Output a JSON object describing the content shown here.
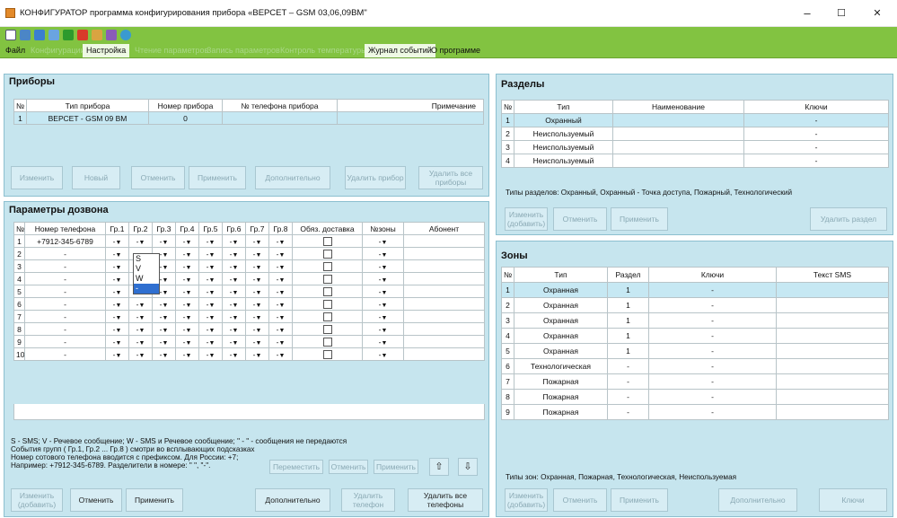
{
  "window": {
    "title": "КОНФИГУРАТОР программа конфигурирования прибора «ВЕРСЕТ – GSM 03,06,09ВМ\"",
    "minimize": "–",
    "maximize": "☐",
    "close": "✕"
  },
  "menu": {
    "items": [
      "Файл",
      "Конфигурации",
      "Настройка",
      "Чтение параметров",
      "Запись параметров",
      "Контроль температуры",
      "Журнал событий",
      "О программе"
    ]
  },
  "devices": {
    "title": "Приборы",
    "headers": [
      "№",
      "Тип прибора",
      "Номер прибора",
      "№ телефона прибора",
      "Примечание"
    ],
    "rows": [
      [
        "1",
        "ВЕРСЕТ - GSM 09 ВМ",
        "0",
        "",
        ""
      ]
    ],
    "buttons": [
      "Изменить",
      "Новый",
      "Отменить",
      "Применить",
      "Дополнительно",
      "Удалить прибор",
      "Удалить все приборы"
    ]
  },
  "dial": {
    "title": "Параметры дозвона",
    "headers": [
      "№",
      "Номер телефона",
      "Гр.1",
      "Гр.2",
      "Гр.3",
      "Гр.4",
      "Гр.5",
      "Гр.6",
      "Гр.7",
      "Гр.8",
      "Обяз. доставка",
      "№зоны",
      "Абонент"
    ],
    "rows": [
      [
        "1",
        "+7912-345-6789",
        "-",
        "-",
        "-",
        "-",
        "-",
        "-",
        "-",
        "-",
        "",
        "-",
        ""
      ],
      [
        "2",
        "-",
        "-",
        "-",
        "-",
        "-",
        "-",
        "-",
        "-",
        "-",
        "",
        "-",
        ""
      ],
      [
        "3",
        "-",
        "-",
        "-",
        "-",
        "-",
        "-",
        "-",
        "-",
        "-",
        "",
        "-",
        ""
      ],
      [
        "4",
        "-",
        "-",
        "-",
        "-",
        "-",
        "-",
        "-",
        "-",
        "-",
        "",
        "-",
        ""
      ],
      [
        "5",
        "-",
        "-",
        "-",
        "-",
        "-",
        "-",
        "-",
        "-",
        "-",
        "",
        "-",
        ""
      ],
      [
        "6",
        "-",
        "-",
        "-",
        "-",
        "-",
        "-",
        "-",
        "-",
        "-",
        "",
        "-",
        ""
      ],
      [
        "7",
        "-",
        "-",
        "-",
        "-",
        "-",
        "-",
        "-",
        "-",
        "-",
        "",
        "-",
        ""
      ],
      [
        "8",
        "-",
        "-",
        "-",
        "-",
        "-",
        "-",
        "-",
        "-",
        "-",
        "",
        "-",
        ""
      ],
      [
        "9",
        "-",
        "-",
        "-",
        "-",
        "-",
        "-",
        "-",
        "-",
        "-",
        "",
        "-",
        ""
      ],
      [
        "10",
        "-",
        "-",
        "-",
        "-",
        "-",
        "-",
        "-",
        "-",
        "-",
        "",
        "-",
        ""
      ]
    ],
    "dropdown_options": [
      "S",
      "V",
      "W",
      "-"
    ],
    "notes": [
      "S - SMS;  V - Речевое сообщение;  W - SMS и Речевое сообщение; \" - \" - сообщения не передаются",
      "События групп ( Гр.1, Гр.2 ... Гр.8 ) смотри во всплывающих подсказках",
      "Номер сотового телефона вводится с префиксом. Для России: +7;",
      "Например: +7912-345-6789. Разделители в номере: \" \", \"-\"."
    ],
    "small_buttons": [
      "Переместить",
      "Отменить",
      "Применить"
    ],
    "buttons": [
      "Изменить (добавить)",
      "Отменить",
      "Применить",
      "Дополнительно",
      "Удалить телефон",
      "Удалить все телефоны"
    ]
  },
  "sections": {
    "title": "Разделы",
    "headers": [
      "№",
      "Тип",
      "Наименование",
      "Ключи"
    ],
    "rows": [
      [
        "1",
        "Охранный",
        "",
        "-"
      ],
      [
        "2",
        "Неиспользуемый",
        "",
        "-"
      ],
      [
        "3",
        "Неиспользуемый",
        "",
        "-"
      ],
      [
        "4",
        "Неиспользуемый",
        "",
        "-"
      ]
    ],
    "types_note": "Типы разделов: Охранный, Охранный - Точка доступа, Пожарный, Технологический",
    "buttons": [
      "Изменить (добавить)",
      "Отменить",
      "Применить",
      "Удалить раздел"
    ]
  },
  "zones": {
    "title": "Зоны",
    "headers": [
      "№",
      "Тип",
      "Раздел",
      "Ключи",
      "Текст SMS"
    ],
    "rows": [
      [
        "1",
        "Охранная",
        "1",
        "-",
        ""
      ],
      [
        "2",
        "Охранная",
        "1",
        "-",
        ""
      ],
      [
        "3",
        "Охранная",
        "1",
        "-",
        ""
      ],
      [
        "4",
        "Охранная",
        "1",
        "-",
        ""
      ],
      [
        "5",
        "Охранная",
        "1",
        "-",
        ""
      ],
      [
        "6",
        "Технологическая",
        "-",
        "-",
        ""
      ],
      [
        "7",
        "Пожарная",
        "-",
        "-",
        ""
      ],
      [
        "8",
        "Пожарная",
        "-",
        "-",
        ""
      ],
      [
        "9",
        "Пожарная",
        "-",
        "-",
        ""
      ]
    ],
    "types_note": "Типы зон: Охранная, Пожарная, Технологическая, Неиспользуемая",
    "buttons": [
      "Изменить (добавить)",
      "Отменить",
      "Применить",
      "Дополнительно",
      "Ключи"
    ]
  }
}
